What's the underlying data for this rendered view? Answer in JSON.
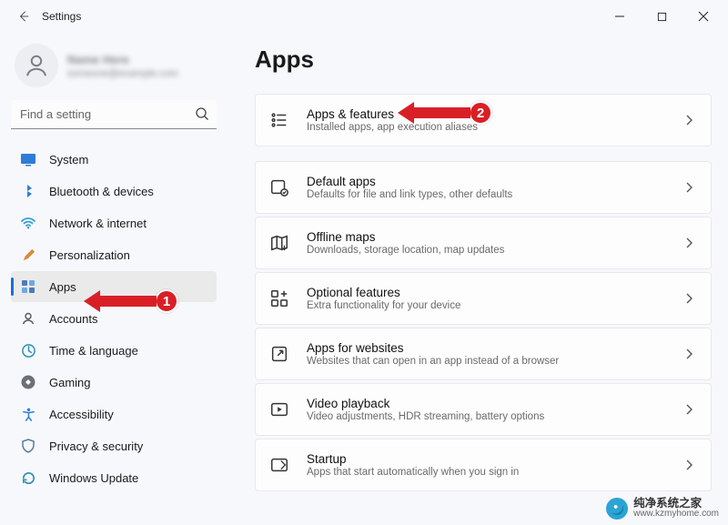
{
  "titlebar": {
    "title": "Settings"
  },
  "account": {
    "name": "Name Here",
    "email": "someone@example.com"
  },
  "search": {
    "placeholder": "Find a setting"
  },
  "nav": [
    {
      "key": "system",
      "label": "System"
    },
    {
      "key": "bluetooth",
      "label": "Bluetooth & devices"
    },
    {
      "key": "network",
      "label": "Network & internet"
    },
    {
      "key": "personalization",
      "label": "Personalization"
    },
    {
      "key": "apps",
      "label": "Apps",
      "selected": true
    },
    {
      "key": "accounts",
      "label": "Accounts"
    },
    {
      "key": "time",
      "label": "Time & language"
    },
    {
      "key": "gaming",
      "label": "Gaming"
    },
    {
      "key": "accessibility",
      "label": "Accessibility"
    },
    {
      "key": "privacy",
      "label": "Privacy & security"
    },
    {
      "key": "update",
      "label": "Windows Update"
    }
  ],
  "main": {
    "title": "Apps",
    "cards": [
      {
        "title": "Apps & features",
        "sub": "Installed apps, app execution aliases"
      },
      {
        "title": "Default apps",
        "sub": "Defaults for file and link types, other defaults"
      },
      {
        "title": "Offline maps",
        "sub": "Downloads, storage location, map updates"
      },
      {
        "title": "Optional features",
        "sub": "Extra functionality for your device"
      },
      {
        "title": "Apps for websites",
        "sub": "Websites that can open in an app instead of a browser"
      },
      {
        "title": "Video playback",
        "sub": "Video adjustments, HDR streaming, battery options"
      },
      {
        "title": "Startup",
        "sub": "Apps that start automatically when you sign in"
      }
    ]
  },
  "callouts": {
    "badge1": "1",
    "badge2": "2"
  },
  "watermark": {
    "name": "纯净系统之家",
    "url": "www.kzmyhome.com"
  }
}
